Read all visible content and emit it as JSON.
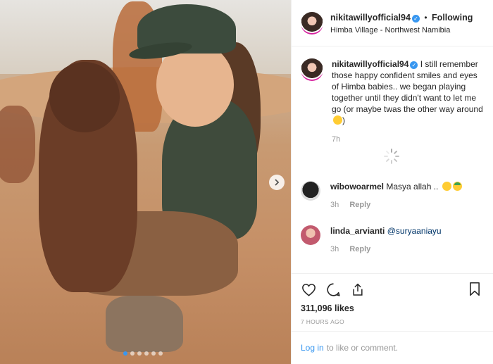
{
  "post": {
    "username": "nikitawillyofficial94",
    "follow_status": "Following",
    "location": "Himba Village - Northwest Namibia",
    "caption": "I still remember those happy confident smiles and eyes of Himba babies.. we began playing together until they didn't want to let me go (or maybe twas the other way around",
    "caption_emoji": "sweat-smile-emoji",
    "caption_time": "7h",
    "likes": "311,096 likes",
    "time_ago": "7 HOURS AGO",
    "carousel_slide_count": 6,
    "carousel_active_index": 0
  },
  "comments": [
    {
      "username": "wibowoarmel",
      "text": "Masya allah ..",
      "emojis": [
        "kiss-emoji",
        "smile-with-cap-emoji"
      ],
      "time": "3h",
      "reply_label": "Reply"
    },
    {
      "username": "linda_arvianti",
      "text": "@suryaaniayu",
      "time": "3h",
      "reply_label": "Reply"
    }
  ],
  "footer": {
    "login_label": "Log in",
    "suffix": "to like or comment."
  },
  "icons": {
    "like": "heart-icon",
    "comment": "comment-icon",
    "share": "share-icon",
    "save": "bookmark-icon",
    "next": "chevron-right-icon"
  },
  "colors": {
    "accent": "#3897f0",
    "text": "#262626",
    "muted": "#999999",
    "border": "#efefef"
  }
}
